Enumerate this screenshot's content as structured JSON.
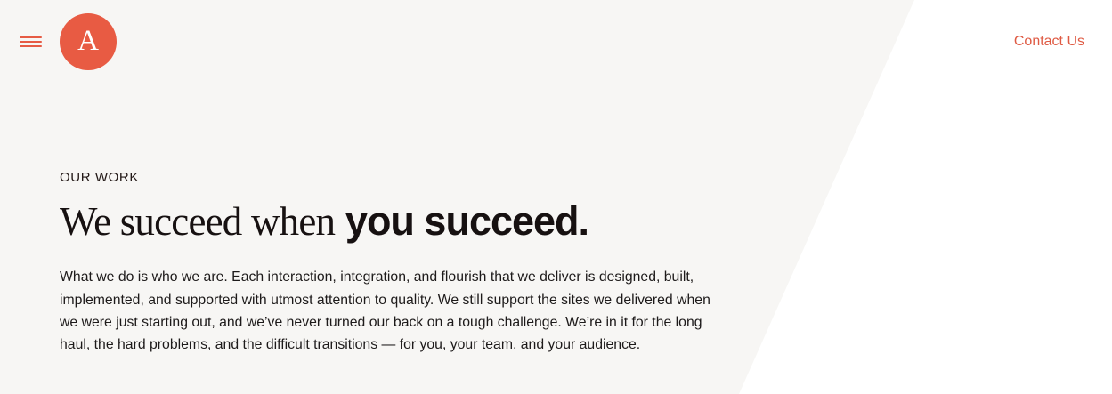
{
  "header": {
    "logo_text": "A",
    "contact_label": "Contact Us"
  },
  "main": {
    "eyebrow": "OUR WORK",
    "headline_regular": "We succeed when",
    "headline_bold": "you succeed.",
    "body": "What we do is who we are. Each interaction, integration, and flourish that we deliver is designed, built, implemented, and supported with utmost attention to quality. We still support the sites we delivered when we were just starting out, and we’ve never turned our back on a tough challenge. We’re in it for the long haul, the hard problems, and the difficult transitions — for you, your team, and your audience."
  },
  "icons": {
    "menu": "hamburger-menu-icon",
    "logo": "brand-logo-icon"
  },
  "colors": {
    "accent": "#e85b43",
    "background": "#f7f6f4",
    "text": "#1a1412",
    "page": "#ffffff"
  }
}
